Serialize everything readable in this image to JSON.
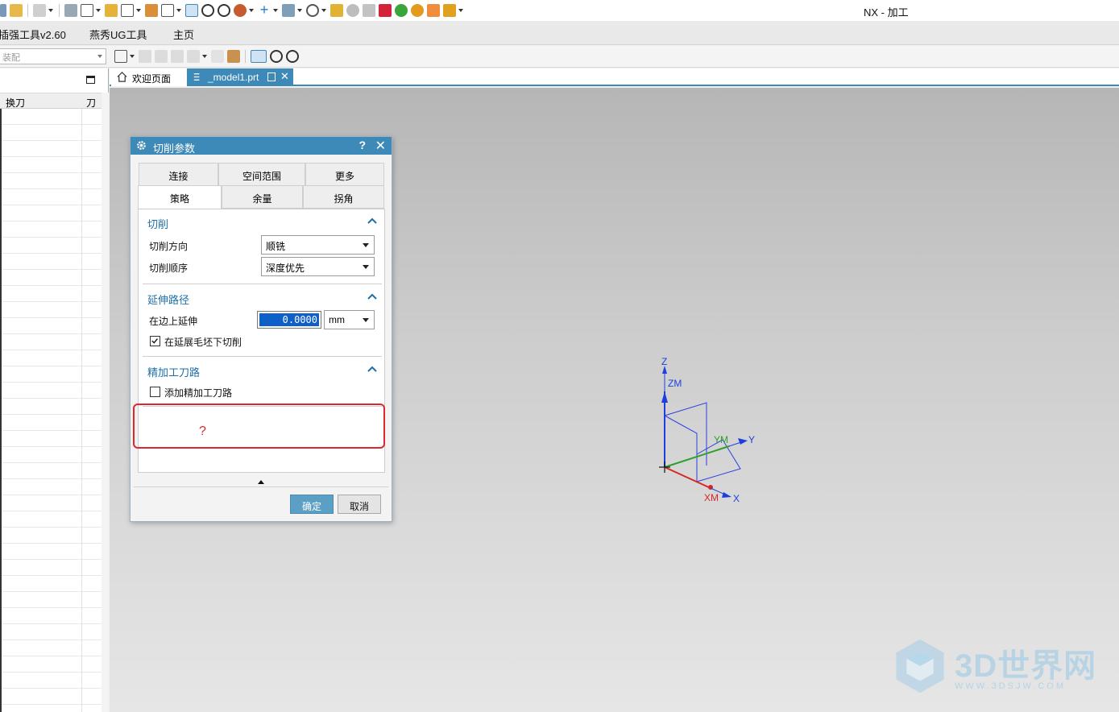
{
  "app": {
    "title": "NX - 加工"
  },
  "menubar": {
    "items": [
      "插强工具v2.60",
      "燕秀UG工具",
      "主页"
    ]
  },
  "toolbar2": {
    "filter_placeholder": "装配"
  },
  "navigator": {
    "columns": [
      "换刀",
      "刀"
    ]
  },
  "tabs": [
    {
      "label": "欢迎页面",
      "icon": "home-icon"
    },
    {
      "label": "_model1.prt",
      "icon": "part-file-icon"
    }
  ],
  "dialog": {
    "title": "切削参数",
    "help": "?",
    "close": "✕",
    "tabs_row1": [
      "连接",
      "空间范围",
      "更多"
    ],
    "tabs_row2": [
      "策略",
      "余量",
      "拐角"
    ],
    "active_tab": "策略",
    "groups": {
      "cut": {
        "title": "切削",
        "direction_label": "切削方向",
        "direction_value": "顺铣",
        "order_label": "切削顺序",
        "order_value": "深度优先"
      },
      "extend": {
        "title": "延伸路径",
        "extend_label": "在边上延伸",
        "extend_value": "0.0000",
        "unit": "mm",
        "checkbox_label": "在延展毛坯下切削",
        "checkbox_checked": true
      },
      "finish": {
        "title": "精加工刀路",
        "checkbox_label": "添加精加工刀路",
        "checkbox_checked": false
      }
    },
    "annotation": "?",
    "ok_label": "确定",
    "cancel_label": "取消"
  },
  "triad": {
    "labels": [
      "Z",
      "ZM",
      "YM",
      "Y",
      "XM",
      "X"
    ]
  },
  "watermark": {
    "text": "3D世界网",
    "url": "WWW.3DSJW.COM"
  },
  "colors": {
    "accent": "#3d8ab8",
    "highlight": "#e0262b",
    "group_title": "#1f6fa6"
  }
}
